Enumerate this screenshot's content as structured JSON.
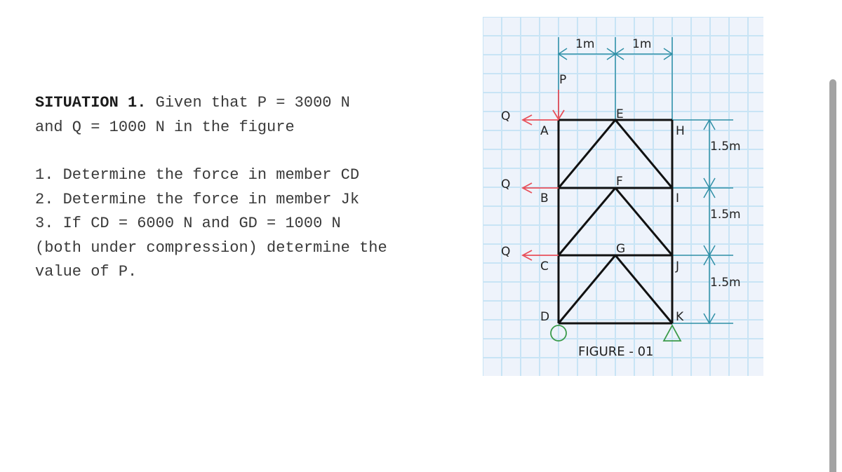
{
  "problem": {
    "heading": "SITUATION 1.",
    "intro_line1": " Given that P = 3000 N",
    "intro_line2": "and Q = 1000 N in the figure",
    "questions": [
      "1. Determine the force in member CD",
      "2. Determine the force in member Jk",
      "3. If CD = 6000 N and GD = 1000 N",
      "(both under compression) determine the",
      "value of P."
    ]
  },
  "figure": {
    "caption": "FIGURE - 01",
    "load_labels": {
      "p": "P",
      "q1": "Q",
      "q2": "Q",
      "q3": "Q"
    },
    "nodes": [
      "A",
      "B",
      "C",
      "D",
      "E",
      "F",
      "G",
      "H",
      "I",
      "J",
      "K"
    ],
    "dimensions": {
      "horizontal": [
        "1m",
        "1m"
      ],
      "vertical": [
        "1.5m",
        "1.5m",
        "1.5m"
      ]
    },
    "colors": {
      "grid_bg": "#eef3fb",
      "grid_line": "#c8e4f5",
      "member": "#111111",
      "load": "#e8505a",
      "dimension": "#2f8fa6",
      "support": "#3a9a4a"
    }
  }
}
